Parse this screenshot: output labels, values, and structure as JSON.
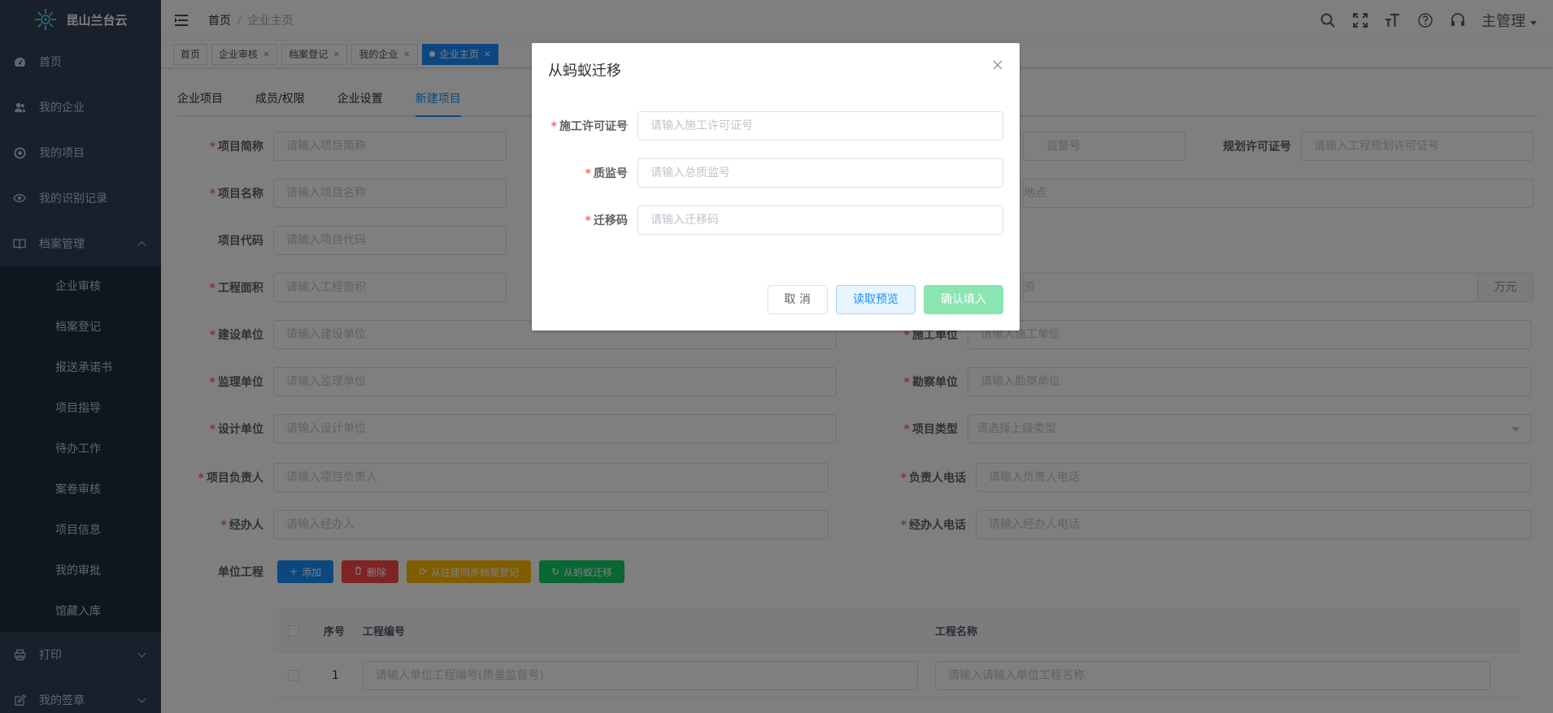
{
  "app": {
    "name": "昆山兰台云"
  },
  "sidebar": {
    "items": [
      {
        "label": "首页",
        "icon": "dashboard-icon"
      },
      {
        "label": "我的企业",
        "icon": "peoples-icon"
      },
      {
        "label": "我的项目",
        "icon": "project-icon"
      },
      {
        "label": "我的识别记录",
        "icon": "eye-icon"
      },
      {
        "label": "档案管理",
        "icon": "book-icon"
      }
    ],
    "archive_sub": [
      "企业审核",
      "档案登记",
      "报送承诺书",
      "项目指导",
      "待办工作",
      "案卷审核",
      "项目信息",
      "我的审批",
      "馆藏入库"
    ],
    "bottom_items": [
      {
        "label": "打印",
        "icon": "print-icon"
      },
      {
        "label": "我的签章",
        "icon": "edit-icon"
      }
    ]
  },
  "navbar": {
    "breadcrumb": [
      "首页",
      "企业主页"
    ],
    "breadcrumb_sep": "/",
    "user": "主管理"
  },
  "tags": [
    {
      "label": "首页",
      "closable": false
    },
    {
      "label": "企业审核",
      "closable": true
    },
    {
      "label": "档案登记",
      "closable": true
    },
    {
      "label": "我的企业",
      "closable": true
    },
    {
      "label": "企业主页",
      "closable": true,
      "active": true
    }
  ],
  "tag_close": "×",
  "tabs": [
    "企业项目",
    "成员/权限",
    "企业设置",
    "新建项目"
  ],
  "form": {
    "xmjc": {
      "label": "项目简称",
      "placeholder": "请输入项目简称"
    },
    "jdh": {
      "placeholder": "监督号"
    },
    "ghxkz": {
      "label": "规划许可证号",
      "placeholder": "请输入工程规划许可证号"
    },
    "xmmc": {
      "label": "项目名称",
      "placeholder": "请输入项目名称"
    },
    "dd": {
      "placeholder": "地点"
    },
    "xmdm": {
      "label": "项目代码",
      "placeholder": "请输入项目代码"
    },
    "gcmj": {
      "label": "工程面积",
      "placeholder": "请输入工程面积"
    },
    "tz": {
      "placeholder": "资",
      "append": "万元"
    },
    "jsdw": {
      "label": "建设单位",
      "placeholder": "请输入建设单位"
    },
    "sgdw": {
      "label": "施工单位",
      "placeholder": "请输入施工单位"
    },
    "jldw": {
      "label": "监理单位",
      "placeholder": "请输入监理单位"
    },
    "kcdw": {
      "label": "勘察单位",
      "placeholder": "请输入勘察单位"
    },
    "sjdw": {
      "label": "设计单位",
      "placeholder": "请输入设计单位"
    },
    "xmlx": {
      "label": "项目类型",
      "placeholder": "请选择上级类型"
    },
    "xmfzr": {
      "label": "项目负责人",
      "placeholder": "请输入项目负责人"
    },
    "fzrdh": {
      "label": "负责人电话",
      "placeholder": "请输入负责人电话"
    },
    "jbr": {
      "label": "经办人",
      "placeholder": "请输入经办人"
    },
    "jbrdh": {
      "label": "经办人电话",
      "placeholder": "请输入经办人电话"
    },
    "dwgc": {
      "label": "单位工程"
    }
  },
  "unit_buttons": [
    {
      "label": "添加",
      "icon": "+",
      "color": "blue"
    },
    {
      "label": "删除",
      "icon": "🗑",
      "color": "red"
    },
    {
      "label": "从住建同步档案登记",
      "icon": "⟳",
      "color": "yellow"
    },
    {
      "label": "从蚂蚁迁移",
      "icon": "↻",
      "color": "green"
    }
  ],
  "table": {
    "headers": [
      "序号",
      "工程编号",
      "工程名称"
    ],
    "rows": [
      {
        "index": "1",
        "code_placeholder": "请输入单位工程编号(质量监督号)",
        "name_placeholder": "请输入请输入单位工程名称"
      }
    ]
  },
  "dialog": {
    "title": "从蚂蚁迁移",
    "fields": [
      {
        "label": "施工许可证号",
        "placeholder": "请输入施工许可证号"
      },
      {
        "label": "质监号",
        "placeholder": "请输入总质监号"
      },
      {
        "label": "迁移码",
        "placeholder": "请输入迁移码"
      }
    ],
    "cancel": "取 消",
    "preview": "读取预览",
    "confirm": "确认填入"
  },
  "colors": {
    "primary": "#1890ff",
    "sidebar": "#304156",
    "danger": "#ff4949",
    "warning": "#ffba00",
    "success": "#13ce66"
  }
}
